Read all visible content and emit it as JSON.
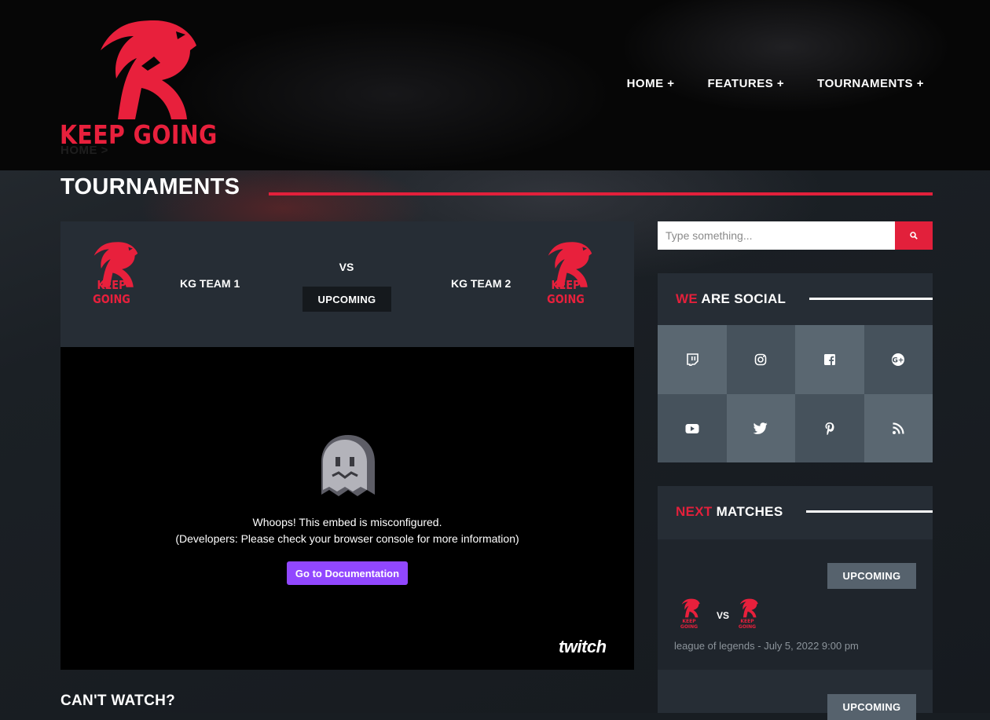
{
  "header": {
    "logo_text": "KEEP GOING",
    "breadcrumb": "HOME  >",
    "nav": [
      "HOME +",
      "FEATURES +",
      "TOURNAMENTS +"
    ]
  },
  "page": {
    "title": "TOURNAMENTS"
  },
  "match": {
    "team1": "KG TEAM 1",
    "team2": "KG TEAM 2",
    "vs": "VS",
    "status": "UPCOMING",
    "team_logo_text": "KEEP GOING"
  },
  "embed": {
    "message": "Whoops! This embed is misconfigured.",
    "sub_message": "(Developers: Please check your browser console for more information)",
    "button_label": "Go to Documentation",
    "brand": "twitch"
  },
  "cant_watch": "CAN'T WATCH?",
  "search": {
    "placeholder": "Type something..."
  },
  "social": {
    "title_highlight": "WE",
    "title_rest": " ARE SOCIAL",
    "icons": [
      "twitch-icon",
      "instagram-icon",
      "facebook-icon",
      "google-plus-icon",
      "youtube-icon",
      "twitter-icon",
      "pinterest-icon",
      "rss-icon"
    ]
  },
  "next_matches": {
    "title_highlight": "NEXT",
    "title_rest": " MATCHES",
    "items": [
      {
        "status": "UPCOMING",
        "vs": "VS",
        "meta": "league of legends - July 5, 2022 9:00 pm",
        "logo_text": "KEEP GOING"
      },
      {
        "status": "UPCOMING"
      }
    ]
  },
  "colors": {
    "accent": "#e2203b",
    "twitch": "#9147ff",
    "card": "#262d35"
  }
}
